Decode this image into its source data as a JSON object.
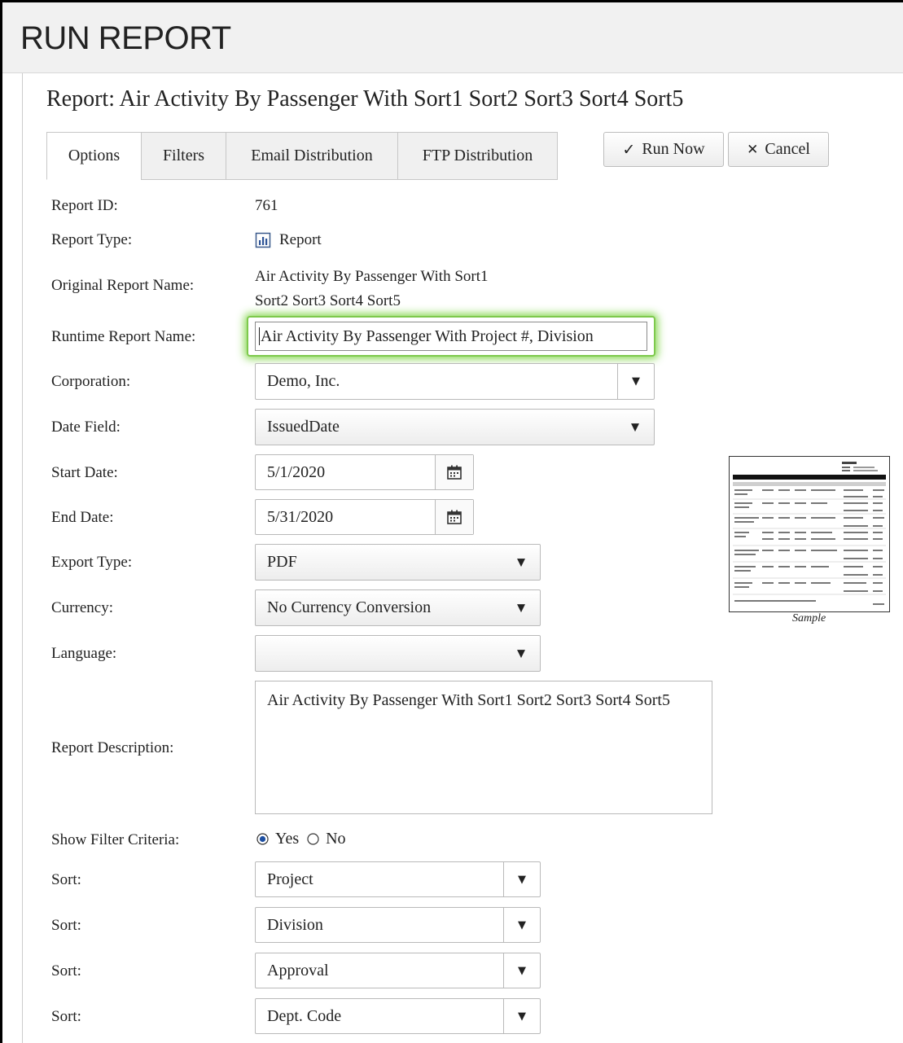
{
  "app": {
    "title": "RUN REPORT"
  },
  "report": {
    "heading": "Report:  Air Activity By Passenger With Sort1 Sort2 Sort3 Sort4 Sort5"
  },
  "tabs": [
    {
      "label": "Options",
      "active": true
    },
    {
      "label": "Filters",
      "active": false
    },
    {
      "label": "Email Distribution",
      "active": false
    },
    {
      "label": "FTP Distribution",
      "active": false
    }
  ],
  "actions": {
    "run_label": "Run Now",
    "cancel_label": "Cancel"
  },
  "fields": {
    "report_id": {
      "label": "Report ID:",
      "value": "761"
    },
    "report_type": {
      "label": "Report Type:",
      "value": "Report",
      "icon": "report-chart-icon"
    },
    "original_name": {
      "label": "Original Report Name:",
      "line1": "Air Activity By Passenger With Sort1",
      "line2": "Sort2 Sort3 Sort4 Sort5"
    },
    "runtime_name": {
      "label": "Runtime Report Name:",
      "value": "Air Activity By Passenger With Project #, Division"
    },
    "corporation": {
      "label": "Corporation:",
      "value": "Demo, Inc."
    },
    "date_field": {
      "label": "Date Field:",
      "value": "IssuedDate"
    },
    "start_date": {
      "label": "Start Date:",
      "value": "5/1/2020"
    },
    "end_date": {
      "label": "End Date:",
      "value": "5/31/2020"
    },
    "export_type": {
      "label": "Export Type:",
      "value": "PDF"
    },
    "currency": {
      "label": "Currency:",
      "value": "No Currency Conversion"
    },
    "language": {
      "label": "Language:",
      "value": ""
    },
    "description": {
      "label": "Report Description:",
      "value": "Air Activity By Passenger With Sort1 Sort2 Sort3 Sort4 Sort5"
    },
    "show_filter": {
      "label": "Show Filter Criteria:",
      "yes_label": "Yes",
      "no_label": "No",
      "selected": "Yes"
    }
  },
  "sorts": [
    {
      "label": "Sort:",
      "value": "Project"
    },
    {
      "label": "Sort:",
      "value": "Division"
    },
    {
      "label": "Sort:",
      "value": "Approval"
    },
    {
      "label": "Sort:",
      "value": "Dept. Code"
    }
  ],
  "sample": {
    "caption": "Sample"
  },
  "colors": {
    "focus_glow": "#7ec94d",
    "border": "#b9b9b9",
    "tab_bg": "#f0f0f0"
  }
}
